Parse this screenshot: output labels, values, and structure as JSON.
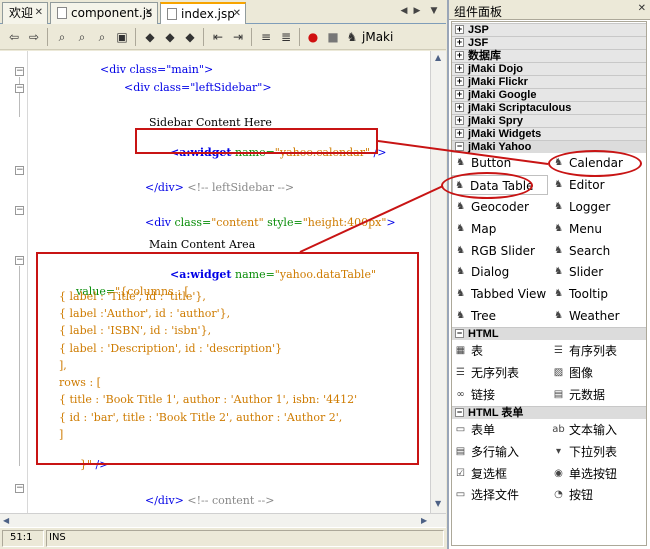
{
  "tabs": [
    {
      "label": "欢迎"
    },
    {
      "label": "component.js"
    },
    {
      "label": "index.jsp"
    }
  ],
  "toolbar": {
    "jmaki_label": "jMaki"
  },
  "code": {
    "line1": "<div class=\"main\">",
    "line2": "<div class=\"leftSidebar\">",
    "line3": "Sidebar Content Here",
    "line4_tag": "<a:widget",
    "line4_attr": " name=",
    "line4_val": "\"yahoo.calendar\"",
    "line4_end": " />",
    "line5_tag": "</div>",
    "line5_cmt": " <!-- leftSidebar -->",
    "line6_tag": "<div",
    "line6_a1": " class=",
    "line6_v1": "\"content\"",
    "line6_a2": " style=",
    "line6_v2": "\"height:400px\"",
    "line6_end": ">",
    "line7": "Main Content Area",
    "line8_tag": "<a:widget",
    "line8_attr": " name=",
    "line8_val": "\"yahoo.dataTable\"",
    "line9_attr": "value=",
    "line9_val": "\"{columns : [",
    "line10": "{ label : 'Title', id : 'title'},",
    "line11": "{ label :'Author', id : 'author'},",
    "line12": "{ label : 'ISBN', id : 'isbn'},",
    "line13": "{ label : 'Description', id : 'description'}",
    "line14": "],",
    "line15": "rows : [",
    "line16": "{ title : 'Book Title 1', author : 'Author 1', isbn: '4412'",
    "line17": "{ id : 'bar', title : 'Book Title 2', author : 'Author 2',",
    "line18": "]",
    "line19_val": "}\"",
    "line19_end": " />",
    "line20_tag": "</div>",
    "line20_cmt": " <!-- content -->"
  },
  "status": {
    "position": "51:1",
    "mode": "INS"
  },
  "palette": {
    "title": "组件面板",
    "collapsed_categories": [
      "JSP",
      "JSF",
      "数据库",
      "jMaki Dojo",
      "jMaki Flickr",
      "jMaki Google",
      "jMaki Scriptaculous",
      "jMaki Spry",
      "jMaki Widgets"
    ],
    "yahoo": {
      "label": "jMaki Yahoo",
      "items": [
        "Button",
        "Calendar",
        "Data Table",
        "Editor",
        "Geocoder",
        "Logger",
        "Map",
        "Menu",
        "RGB Slider",
        "Search",
        "Dialog",
        "Slider",
        "Tabbed View",
        "Tooltip",
        "Tree",
        "Weather"
      ]
    },
    "html": {
      "label": "HTML",
      "items": [
        "表",
        "有序列表",
        "无序列表",
        "图像",
        "链接",
        "元数据"
      ]
    },
    "html_forms": {
      "label": "HTML 表单",
      "items": [
        "表单",
        "文本输入",
        "多行输入",
        "下拉列表",
        "复选框",
        "单选按钮",
        "选择文件",
        "按钮"
      ]
    }
  },
  "colors": {
    "annotation": "#c81414",
    "tag": "#0000e6",
    "attr": "#098d09",
    "value": "#ce7b00"
  }
}
